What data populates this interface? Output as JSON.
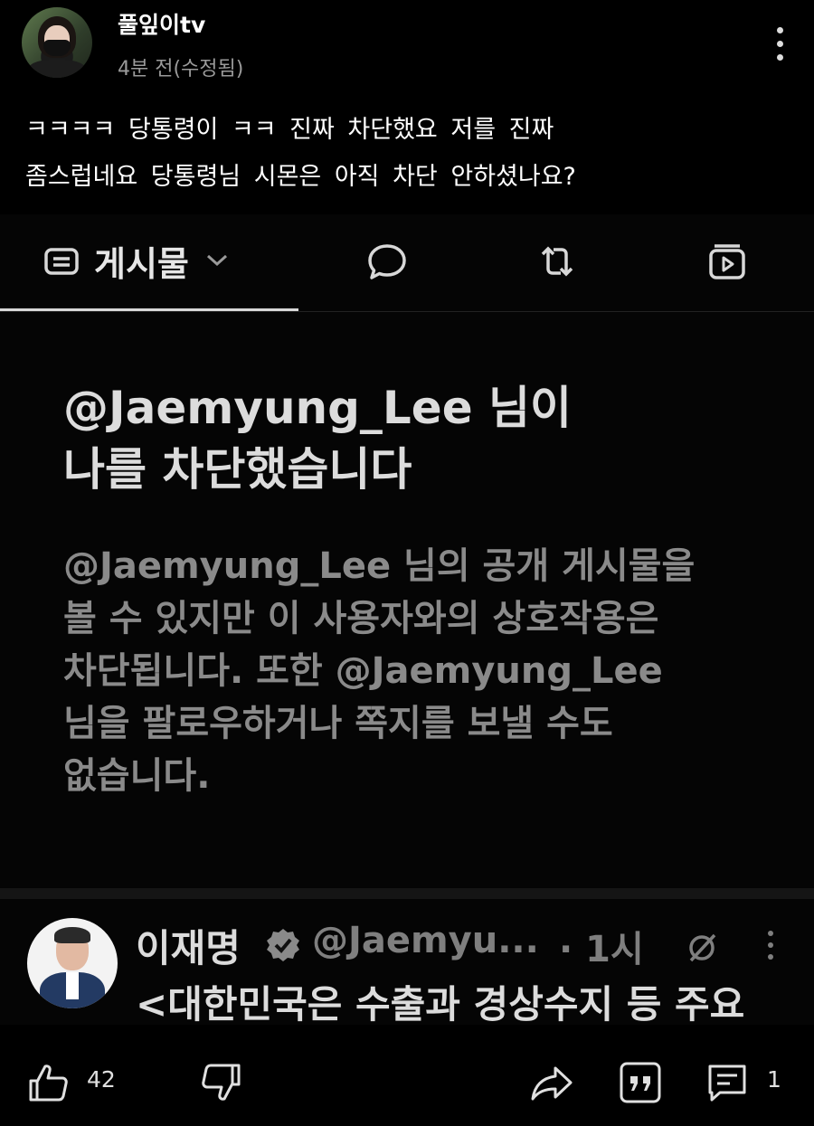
{
  "post": {
    "username": "풀잎이tv",
    "timestamp": "4분 전(수정됨)",
    "text_line1": "ㅋㅋㅋㅋ  당통령이 ㅋㅋ  진짜  차단했요   저를   진짜",
    "text_line2": "좀스럽네요 당통령님  시몬은  아직 차단 안하셨나요?"
  },
  "embed": {
    "tabs": {
      "posts_label": "게시물",
      "icons": [
        "posts-icon",
        "reply-icon",
        "repost-icon",
        "media-icon"
      ]
    },
    "block_title_line1": "@Jaemyung_Lee 님이",
    "block_title_line2": "나를 차단했습니다",
    "block_desc_lines": [
      "@Jaemyung_Lee 님의 공개 게시물을",
      "볼 수 있지만 이 사용자와의 상호작용은",
      "차단됩니다. 또한 @Jaemyung_Lee",
      "님을 팔로우하거나 쪽지를 보낼 수도",
      "없습니다."
    ],
    "tweet": {
      "name": "이재명",
      "handle": "@Jaemyu...",
      "time": "· 1시",
      "text": "<대한민국은 수출과 경상수지 등 주요"
    }
  },
  "actions": {
    "like_count": "42",
    "comment_count": "1"
  },
  "colors": {
    "background": "#000000",
    "muted_text": "#9a9a9a",
    "verified_badge": "#8a8a8a"
  }
}
